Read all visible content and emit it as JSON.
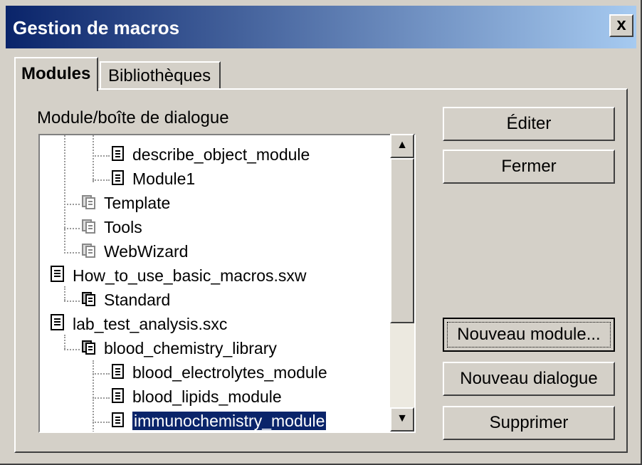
{
  "window": {
    "title": "Gestion de macros",
    "close_label": "x"
  },
  "tabs": [
    {
      "label": "Modules",
      "active": true
    },
    {
      "label": "Bibliothèques",
      "active": false
    }
  ],
  "tree_label": "Module/boîte de dialogue",
  "tree": {
    "items": [
      {
        "label": "describe_object_module",
        "icon": "module-icon"
      },
      {
        "label": "Module1",
        "icon": "module-icon"
      },
      {
        "label": "Template",
        "icon": "library-icon"
      },
      {
        "label": "Tools",
        "icon": "library-icon"
      },
      {
        "label": "WebWizard",
        "icon": "library-icon"
      },
      {
        "label": "How_to_use_basic_macros.sxw",
        "icon": "document-icon"
      },
      {
        "label": "Standard",
        "icon": "library-icon"
      },
      {
        "label": "lab_test_analysis.sxc",
        "icon": "document-icon"
      },
      {
        "label": "blood_chemistry_library",
        "icon": "library-icon"
      },
      {
        "label": "blood_electrolytes_module",
        "icon": "module-icon"
      },
      {
        "label": "blood_lipids_module",
        "icon": "module-icon"
      },
      {
        "label": "immunochemistry_module",
        "icon": "module-icon",
        "selected": true
      }
    ]
  },
  "buttons": {
    "edit": "Éditer",
    "close": "Fermer",
    "new_module": "Nouveau module...",
    "new_dialog": "Nouveau dialogue",
    "delete": "Supprimer"
  },
  "colors": {
    "title_start": "#0a246a",
    "title_end": "#a6caf0",
    "selection": "#0a246a",
    "face": "#d4d0c8"
  }
}
